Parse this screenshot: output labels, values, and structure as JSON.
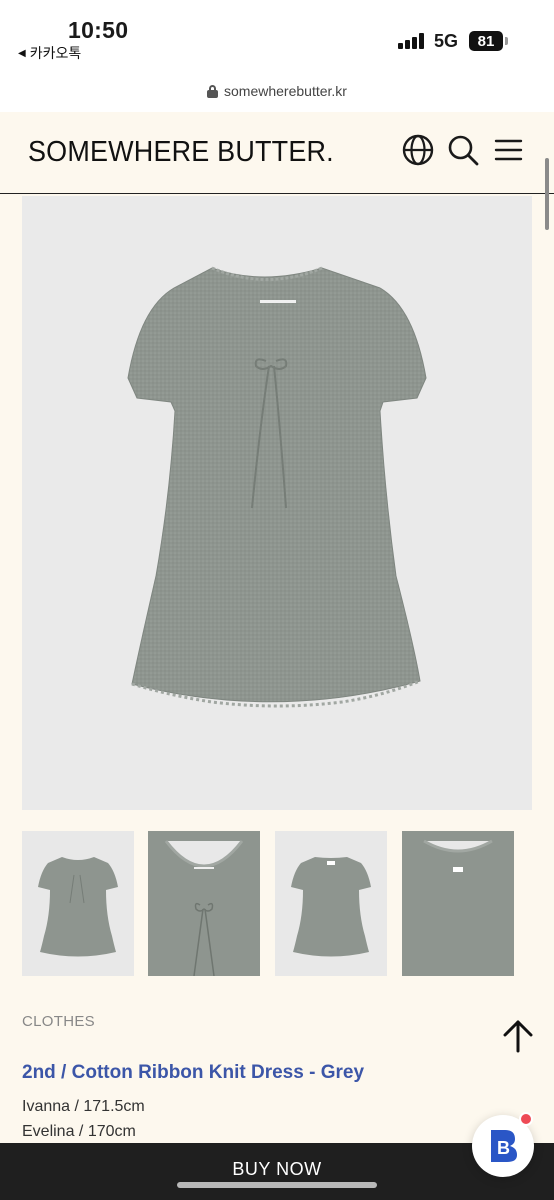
{
  "status_bar": {
    "time": "10:50",
    "back_app": "카카오톡",
    "network": "5G",
    "battery": "81"
  },
  "browser": {
    "url": "somewherebutter.kr"
  },
  "header": {
    "brand": "SOMEWHERE BUTTER.",
    "icons": [
      "globe-icon",
      "search-icon",
      "menu-icon"
    ]
  },
  "product": {
    "category": "CLOTHES",
    "title": "2nd / Cotton Ribbon Knit Dress - Grey",
    "models": [
      "Ivanna / 171.5cm",
      "Evelina / 170cm"
    ]
  },
  "thumbnails": [
    "front-view",
    "neckline-detail",
    "back-view",
    "back-detail"
  ],
  "actions": {
    "buy_now": "BUY NOW",
    "chat_logo": "B"
  },
  "colors": {
    "background": "#fdf8ee",
    "title_blue": "#3c56a8",
    "buy_bar": "#1f1f1f",
    "dress_grey": "#8e958f",
    "notification_red": "#ee4a55"
  }
}
